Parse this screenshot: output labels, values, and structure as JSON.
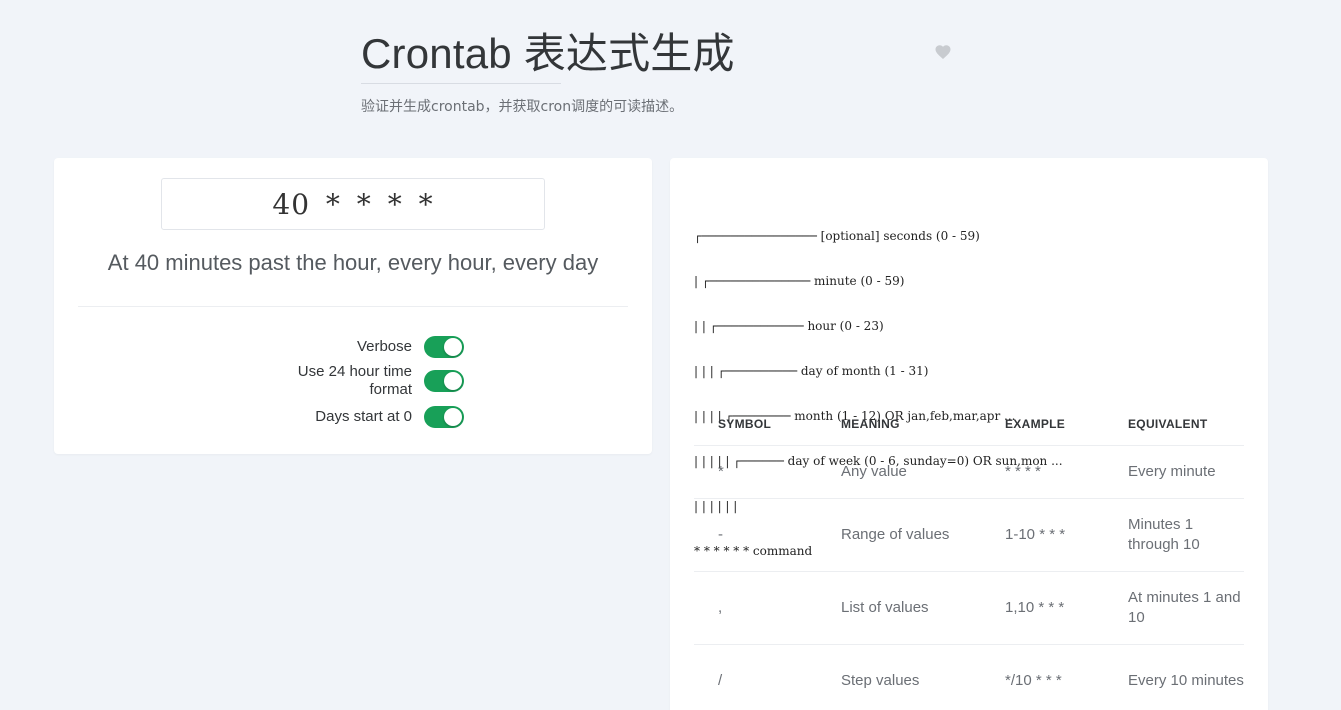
{
  "header": {
    "title": "Crontab 表达式生成",
    "subtitle": "验证并生成crontab，并获取cron调度的可读描述。",
    "favorite_icon": "heart-icon"
  },
  "generator": {
    "expression": "40 * * * *",
    "description": "At 40 minutes past the hour, every hour, every day",
    "options": [
      {
        "label": "Verbose",
        "enabled": true
      },
      {
        "label": "Use 24 hour time format",
        "enabled": true
      },
      {
        "label": "Days start at 0",
        "enabled": true
      }
    ]
  },
  "reference": {
    "diagram_lines": [
      "┌──────────────── [optional] seconds (0 - 59)",
      "| ┌────────────── minute (0 - 59)",
      "| | ┌──────────── hour (0 - 23)",
      "| | | ┌────────── day of month (1 - 31)",
      "| | | | ┌──────── month (1 - 12) OR jan,feb,mar,apr ...",
      "| | | | | ┌────── day of week (0 - 6, sunday=0) OR sun,mon ...",
      "| | | | | |",
      "* * * * * * command"
    ],
    "table": {
      "headers": [
        "SYMBOL",
        "MEANING",
        "EXAMPLE",
        "EQUIVALENT"
      ],
      "rows": [
        [
          "*",
          "Any value",
          "* * * *",
          "Every minute"
        ],
        [
          "-",
          "Range of values",
          "1-10 * * *",
          "Minutes 1 through 10"
        ],
        [
          ",",
          "List of values",
          "1,10 * * *",
          "At minutes 1 and 10"
        ],
        [
          "/",
          "Step values",
          "*/10 * * *",
          "Every 10 minutes"
        ]
      ]
    }
  },
  "colors": {
    "background": "#f1f4f9",
    "card": "#ffffff",
    "toggle_on": "#18a058",
    "heart": "#c8cbd0"
  }
}
